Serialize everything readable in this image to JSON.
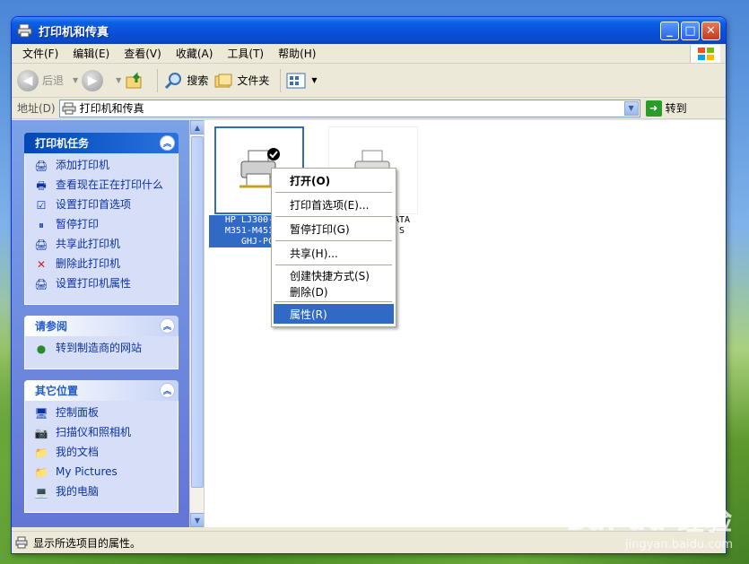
{
  "window": {
    "title": "打印机和传真"
  },
  "menubar": {
    "items": [
      "文件(F)",
      "编辑(E)",
      "查看(V)",
      "收藏(A)",
      "工具(T)",
      "帮助(H)"
    ]
  },
  "toolbar": {
    "back_label": "后退",
    "search_label": "搜索",
    "folders_label": "文件夹"
  },
  "address": {
    "label": "地址(D)",
    "value": "打印机和传真",
    "go_label": "转到"
  },
  "taskpane": {
    "printer_tasks": {
      "title": "打印机任务",
      "items": [
        "添加打印机",
        "查看现在正在打印什么",
        "设置打印首选项",
        "暂停打印",
        "共享此打印机",
        "删除此打印机",
        "设置打印机属性"
      ]
    },
    "see_also": {
      "title": "请参阅",
      "items": [
        "转到制造商的网站"
      ]
    },
    "other_places": {
      "title": "其它位置",
      "items": [
        "控制面板",
        "扫描仪和照相机",
        "我的文档",
        "My Pictures",
        "我的电脑"
      ]
    }
  },
  "printers": [
    {
      "line1": "HP LJ300-400",
      "line2": "M351-M451 PC",
      "line3": "GHJ-PC"
    },
    {
      "line1": "ATA",
      "line2": "S"
    }
  ],
  "context_menu": {
    "items": [
      "打开(O)",
      "打印首选项(E)...",
      "暂停打印(G)",
      "共享(H)...",
      "创建快捷方式(S)",
      "删除(D)",
      "属性(R)"
    ]
  },
  "status": {
    "text": "显示所选项目的属性。"
  },
  "watermark": {
    "logo": "Bai du 经验",
    "url": "jingyan.baidu.com"
  }
}
